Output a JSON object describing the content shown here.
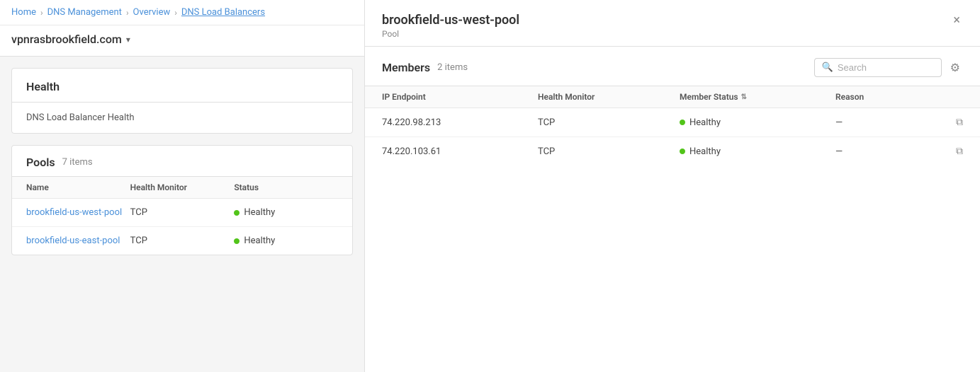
{
  "breadcrumb": {
    "items": [
      "Home",
      "DNS Management",
      "Overview"
    ],
    "current": "DNS Load Balancers"
  },
  "domain": {
    "name": "vpnrasbrookfield.com"
  },
  "health_card": {
    "title": "Health",
    "description": "DNS Load Balancer Health"
  },
  "pools_section": {
    "title": "Pools",
    "count": "7 items",
    "columns": [
      "Name",
      "Health Monitor",
      "Status"
    ],
    "rows": [
      {
        "name": "brookfield-us-west-pool",
        "health_monitor": "TCP",
        "status": "Healthy"
      },
      {
        "name": "brookfield-us-east-pool",
        "health_monitor": "TCP",
        "status": "Healthy"
      }
    ]
  },
  "right_panel": {
    "title": "brookfield-us-west-pool",
    "subtitle": "Pool",
    "close_label": "×",
    "members": {
      "title": "Members",
      "count": "2 items",
      "search_placeholder": "Search",
      "columns": [
        "IP Endpoint",
        "Health Monitor",
        "Member Status",
        "Reason"
      ],
      "rows": [
        {
          "ip_endpoint": "74.220.98.213",
          "health_monitor": "TCP",
          "status": "Healthy",
          "reason": "—"
        },
        {
          "ip_endpoint": "74.220.103.61",
          "health_monitor": "TCP",
          "status": "Healthy",
          "reason": "—"
        }
      ]
    }
  },
  "colors": {
    "healthy_dot": "#52c41a",
    "link_color": "#4a90d9"
  }
}
